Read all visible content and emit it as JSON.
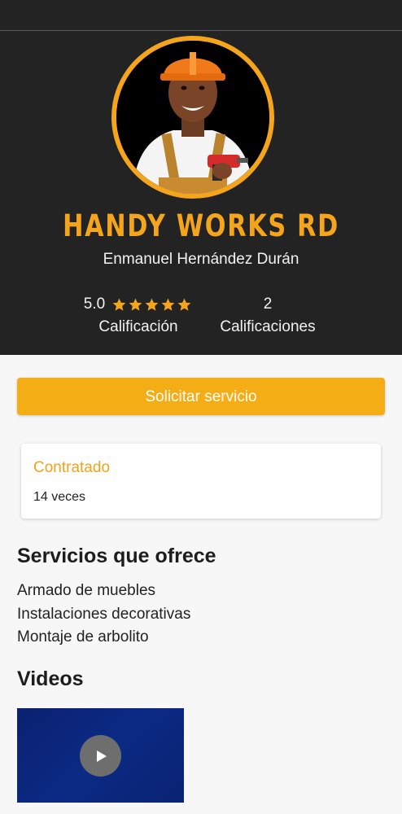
{
  "profile": {
    "business_name": "HANDY WORKS RD",
    "owner_name": "Enmanuel Hernández Durán",
    "avatar_icon": "worker-photo-icon",
    "accent_color": "#f4a51c"
  },
  "rating": {
    "score": "5.0",
    "stars": 5,
    "label": "Calificación"
  },
  "ratings_count": {
    "value": "2",
    "label": "Calificaciones"
  },
  "request_button": {
    "label": "Solicitar servicio"
  },
  "hired": {
    "title": "Contratado",
    "value": "14 veces"
  },
  "services": {
    "title": "Servicios que ofrece",
    "items": [
      "Armado de muebles",
      "Instalaciones decorativas",
      "Montaje de arbolito"
    ]
  },
  "videos": {
    "title": "Videos",
    "play_icon": "play-icon"
  }
}
